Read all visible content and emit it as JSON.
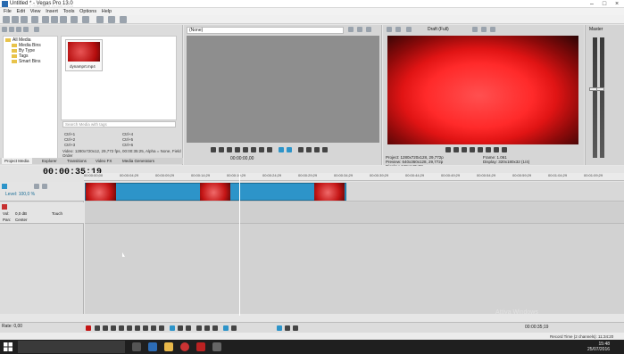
{
  "window": {
    "title": "Untitled * - Vegas Pro 13.0"
  },
  "menu": [
    "File",
    "Edit",
    "View",
    "Insert",
    "Tools",
    "Options",
    "Help"
  ],
  "explorer": {
    "tree": [
      "All Media",
      "Media Bins",
      "By Type",
      "Tags",
      "Smart Bins"
    ],
    "media_file": "dynamprt.mp4",
    "search_placeholder": "Search Media with tags",
    "shortcuts": [
      "Ctrl+1",
      "Ctrl+2",
      "Ctrl+3",
      "Ctrl+4",
      "Ctrl+5",
      "Ctrl+6"
    ],
    "info": [
      "Video: 1280x720x12, 29,772 fps, 00:00:35:25, Alpha = None, Field Order",
      "Audio: 48.000 Hz, Stereo, 00:00:35:25, AAC"
    ],
    "tabs": [
      "Project Media",
      "Explorer",
      "Transitions",
      "Video FX",
      "Media Generators"
    ]
  },
  "trimmer": {
    "selector": "(None)",
    "time": "00:00:00,00"
  },
  "preview": {
    "quality": "Draft (Full)",
    "info_left": [
      "Project: 1280x720x128, 29,772p",
      "Preview: 640x360x128, 29,772p",
      "Display: 249x140x32"
    ],
    "info_right": [
      "Frame: 1.061",
      "Display: 320x180x32 (1/4)"
    ]
  },
  "master": {
    "label": "Master"
  },
  "timeline": {
    "current_time": "00:00:35;19",
    "ruler": [
      "00:00:00;00",
      "00:00:04;29",
      "00:00:09;29",
      "00:00:14;29",
      "00:00:19;29",
      "00:00:24;29",
      "00:00:29;29",
      "00:00:34;29",
      "00:00:39;29",
      "00:00:44;29",
      "00:00:49;29",
      "00:00:54;29",
      "00:00:59;29",
      "00:01:04;29",
      "00:01:09;29"
    ],
    "video_track": {
      "level": "Level: 100,0 %"
    },
    "audio_track": {
      "vol": "Vol:",
      "vol_value": "0,0 dB",
      "touch": "Touch",
      "pan": "Pan:",
      "pan_value": "Center"
    },
    "rate": "Rate: 0,00",
    "end_time": "00:00:35;19"
  },
  "status": {
    "record_time": "Record Time (2 channels): 11:34:20"
  },
  "taskbar": {
    "search": "Chiedimi qualcosa",
    "clock_time": "15:48",
    "clock_date": "25/07/2016"
  },
  "watermark": "Attiva Windows"
}
